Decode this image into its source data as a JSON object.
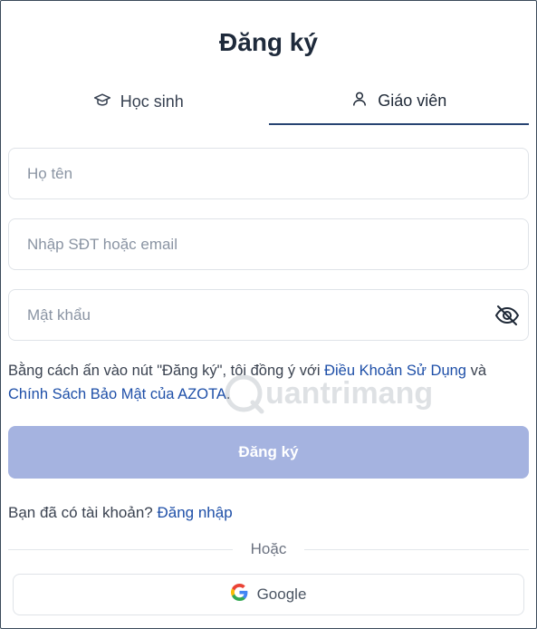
{
  "title": "Đăng ký",
  "tabs": [
    {
      "label": "Học sinh",
      "icon": "graduation-cap-icon",
      "active": false
    },
    {
      "label": "Giáo viên",
      "icon": "user-icon",
      "active": true
    }
  ],
  "form": {
    "name_placeholder": "Họ tên",
    "contact_placeholder": "Nhập SĐT hoặc email",
    "password_placeholder": "Mật khẩu"
  },
  "terms": {
    "prefix": "Bằng cách ấn vào nút \"Đăng ký\", tôi đồng ý với ",
    "terms_link": "Điều Khoản Sử Dụng",
    "middle": " và ",
    "privacy_link": "Chính Sách Bảo Mật của AZOTA",
    "suffix": "."
  },
  "submit_label": "Đăng ký",
  "login": {
    "prompt": "Bạn đã có tài khoản? ",
    "link": "Đăng nhập"
  },
  "divider_label": "Hoặc",
  "google_label": "Google",
  "watermark_text": "uantrimang",
  "colors": {
    "accent": "#274472",
    "link": "#1e4fa8",
    "submit_disabled": "#a5b3e0"
  }
}
